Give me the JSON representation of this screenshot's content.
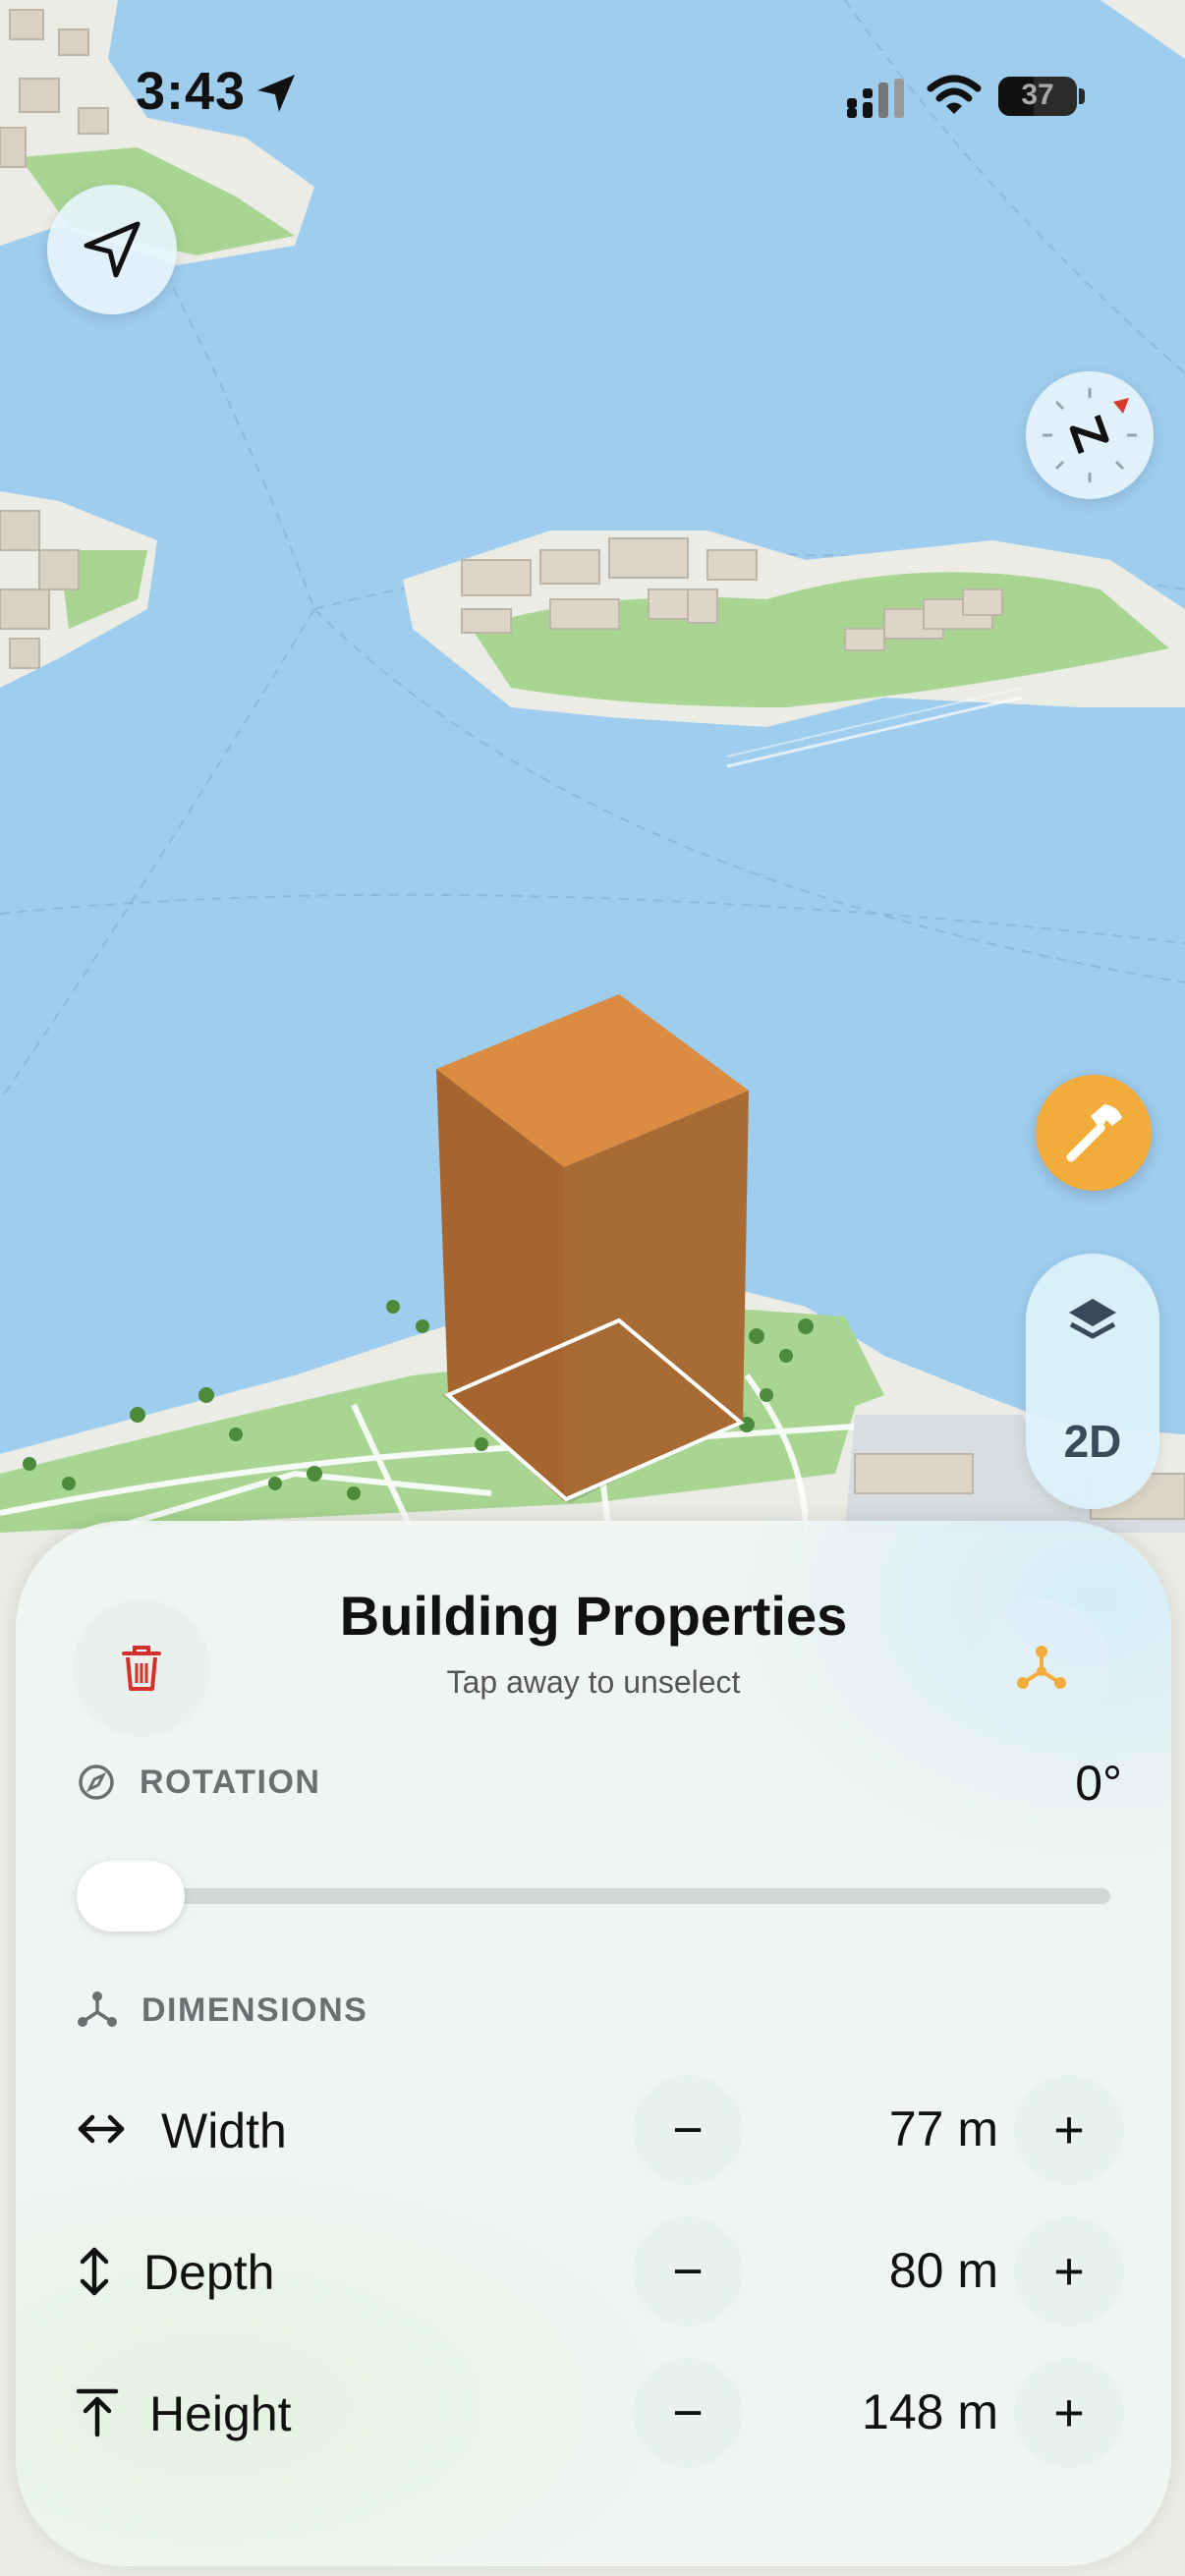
{
  "status_bar": {
    "time": "3:43",
    "battery": "37"
  },
  "map_controls": {
    "mode_toggle_label": "2D"
  },
  "panel": {
    "title": "Building Properties",
    "subtitle": "Tap away to unselect",
    "rotation": {
      "label": "ROTATION",
      "value": "0°",
      "slider_fraction": 0.0
    },
    "dimensions": {
      "label": "DIMENSIONS",
      "rows": [
        {
          "label": "Width",
          "value": "77 m",
          "icon": "horizontal-arrows-icon"
        },
        {
          "label": "Depth",
          "value": "80 m",
          "icon": "vertical-arrows-icon"
        },
        {
          "label": "Height",
          "value": "148 m",
          "icon": "height-arrow-icon"
        }
      ],
      "decrement_symbol": "−",
      "increment_symbol": "+"
    }
  },
  "colors": {
    "water": "#9fcdee",
    "land": "#ebece6",
    "park": "#a9d592",
    "building_top": "#db8c42",
    "building_side": "#a6642f",
    "accent_orange": "#f2ac3c",
    "delete_red": "#d2302b"
  }
}
